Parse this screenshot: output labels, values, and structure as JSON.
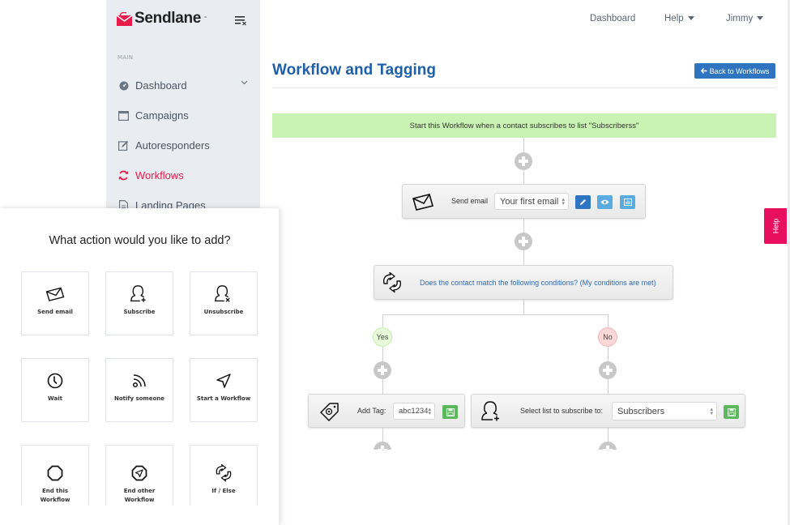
{
  "sidebar": {
    "brand": "Sendlane",
    "brand_color": "#e8194b",
    "section_label": "MAIN",
    "items": [
      {
        "label": "Dashboard",
        "icon": "dashboard-icon",
        "has_chevron": true,
        "active": false
      },
      {
        "label": "Campaigns",
        "icon": "calendar-window-icon",
        "active": false
      },
      {
        "label": "Autoresponders",
        "icon": "edit-icon",
        "active": false
      },
      {
        "label": "Workflows",
        "icon": "refresh-icon",
        "active": true
      },
      {
        "label": "Landing Pages",
        "icon": "document-icon",
        "active": false
      }
    ]
  },
  "topbar": {
    "dashboard": "Dashboard",
    "help": "Help",
    "user": "Jimmy"
  },
  "page": {
    "title": "Workflow and Tagging",
    "back_button": "Back to Workflows",
    "accent_color": "#1f5fa8"
  },
  "workflow": {
    "trigger": "Start this Workflow when a contact subscribes to list \"Subscriberss\"",
    "send_email": {
      "label": "Send email",
      "selected_email": "Your first email"
    },
    "condition": {
      "text": "Does the contact match the following conditions? (My conditions are met)"
    },
    "branches": {
      "yes": "Yes",
      "no": "No"
    },
    "add_tag": {
      "label": "Add Tag:",
      "value": "abc1234"
    },
    "subscribe": {
      "label": "Select list to subscribe to:",
      "value": "Subscribers"
    }
  },
  "help_tab": "Help",
  "picker": {
    "title": "What action would you like to add?",
    "actions": [
      {
        "label": "Send email",
        "icon": "envelope-icon"
      },
      {
        "label": "Subscribe",
        "icon": "user-plus-icon"
      },
      {
        "label": "Unsubscribe",
        "icon": "user-remove-icon"
      },
      {
        "label": "Wait",
        "icon": "clock-icon"
      },
      {
        "label": "Notify someone",
        "icon": "rss-icon"
      },
      {
        "label": "Start a Workflow",
        "icon": "send-icon"
      },
      {
        "label": "End this Workflow",
        "line1": "End this",
        "line2": "Workflow",
        "icon": "octagon-stop-icon"
      },
      {
        "label": "End other Workflow",
        "line1": "End other",
        "line2": "Workflow",
        "icon": "octagon-send-icon"
      },
      {
        "label": "If / Else",
        "icon": "if-else-arrows-icon"
      }
    ]
  }
}
